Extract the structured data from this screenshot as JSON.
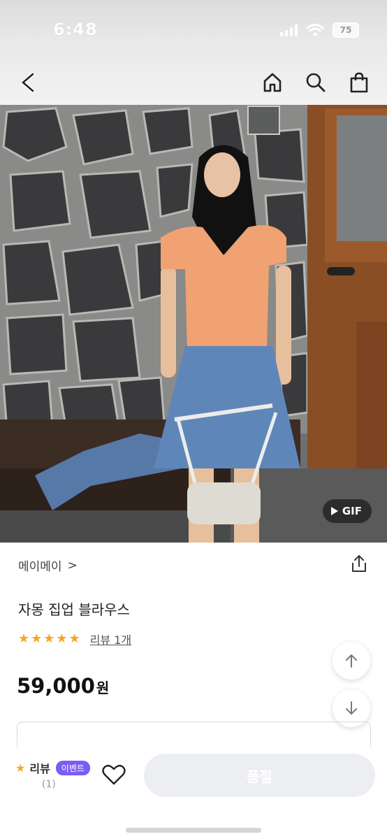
{
  "status_bar": {
    "time": "6:48",
    "battery": "75"
  },
  "header": {
    "back_icon": "chevron-left-icon",
    "home_icon": "home-icon",
    "search_icon": "search-icon",
    "cart_icon": "shopping-bag-icon"
  },
  "hero": {
    "gif_label": "GIF"
  },
  "product": {
    "brand": "메이메이",
    "brand_arrow": ">",
    "title": "자몽 집업 블라우스",
    "stars": [
      "★",
      "★",
      "★",
      "★",
      "★"
    ],
    "review_link": "리뷰 1개",
    "price": "59,000",
    "price_unit": "원"
  },
  "bottom_bar": {
    "review_label": "리뷰",
    "event_badge": "이벤트",
    "review_count": "(1)",
    "soldout_label": "품절"
  },
  "colors": {
    "star": "#f5a623",
    "event": "#7b5cf5"
  }
}
